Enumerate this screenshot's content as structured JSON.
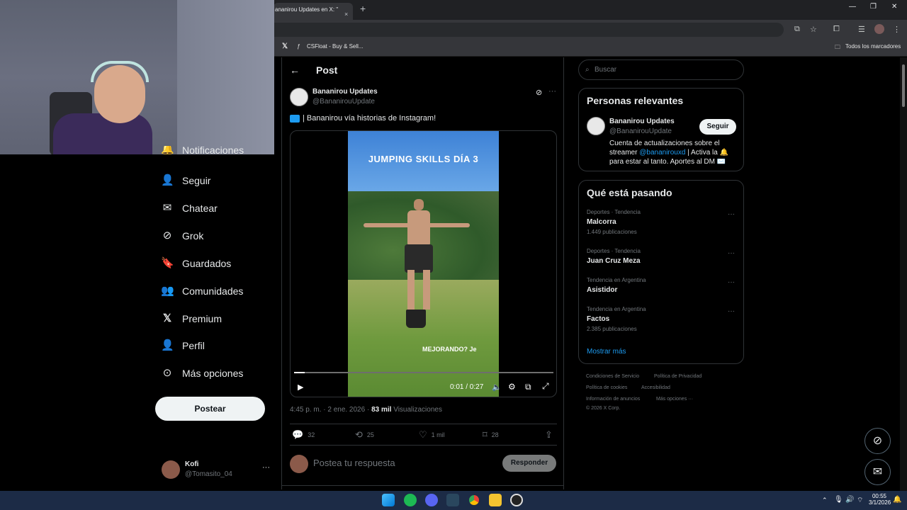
{
  "browser": {
    "tab_title": "ananirou Updates en X: \"",
    "tab_close": "×",
    "new_tab": "+",
    "bookmarks": [
      {
        "icon": "x-logo-icon",
        "label": ""
      },
      {
        "icon": "csfloat-icon",
        "label": "CSFloat - Buy & Sell..."
      }
    ],
    "all_bookmarks": "Todos los marcadores"
  },
  "nav": {
    "items": [
      {
        "label": "Notificaciones",
        "icon": "bell-icon"
      },
      {
        "label": "Seguir",
        "icon": "follow-icon"
      },
      {
        "label": "Chatear",
        "icon": "mail-icon"
      },
      {
        "label": "Grok",
        "icon": "grok-icon"
      },
      {
        "label": "Guardados",
        "icon": "bookmark-icon"
      },
      {
        "label": "Comunidades",
        "icon": "communities-icon"
      },
      {
        "label": "Premium",
        "icon": "x-logo-icon"
      },
      {
        "label": "Perfil",
        "icon": "person-icon"
      },
      {
        "label": "Más opciones",
        "icon": "more-circle-icon"
      }
    ],
    "post_button": "Postear",
    "account": {
      "name": "Kofi",
      "handle": "@Tomasito_04",
      "more": "···"
    }
  },
  "main": {
    "header": "Post",
    "author": {
      "name": "Bananirou Updates",
      "handle": "@BananirouUpdate"
    },
    "text": "| Bananirou vía historias de Instagram!",
    "video": {
      "caption_top": "JUMPING SKILLS DÍA 3",
      "caption_bottom": "MEJORANDO? Je",
      "time": "0:01 / 0:27",
      "progress": 0.04
    },
    "meta": {
      "time": "4:45 p. m. · 2 ene. 2026 · ",
      "views_count": "83 mil",
      "views_label": " Visualizaciones"
    },
    "actions": {
      "replies": "32",
      "reposts": "25",
      "likes": "1 mil",
      "bookmarks": "28"
    },
    "reply_placeholder": "Postea tu respuesta",
    "reply_button": "Responder"
  },
  "sidebar": {
    "search_placeholder": "Buscar",
    "relevant": {
      "title": "Personas relevantes",
      "name": "Bananirou Updates",
      "handle": "@BananirouUpdate",
      "follow": "Seguir",
      "bio_1": "Cuenta de actualizaciones sobre el",
      "bio_2a": "streamer ",
      "bio_mention": "@bananirouxd",
      "bio_2b": " | Activa la 🔔",
      "bio_3": "para estar al tanto. Aportes al DM ✉️"
    },
    "trends": {
      "title": "Qué está pasando",
      "items": [
        {
          "category": "Deportes · Tendencia",
          "name": "Malcorra",
          "count": "1.449 publicaciones"
        },
        {
          "category": "Deportes · Tendencia",
          "name": "Juan Cruz Meza",
          "count": ""
        },
        {
          "category": "Tendencia en Argentina",
          "name": "Asistidor",
          "count": ""
        },
        {
          "category": "Tendencia en Argentina",
          "name": "Factos",
          "count": "2.385 publicaciones"
        }
      ],
      "show_more": "Mostrar más"
    },
    "footer": {
      "l1a": "Condiciones de Servicio",
      "l1b": "Política de Privacidad",
      "l2a": "Política de cookies",
      "l2b": "Accesibilidad",
      "l3a": "Información de anuncios",
      "l3b": "Más opciones ···",
      "l4": "© 2026 X Corp."
    }
  },
  "taskbar": {
    "time": "00:55",
    "date": "3/1/2026"
  },
  "colors": {
    "accent": "#1d9bf0",
    "bg": "#000000",
    "border": "#2f3336",
    "muted": "#71767b"
  }
}
